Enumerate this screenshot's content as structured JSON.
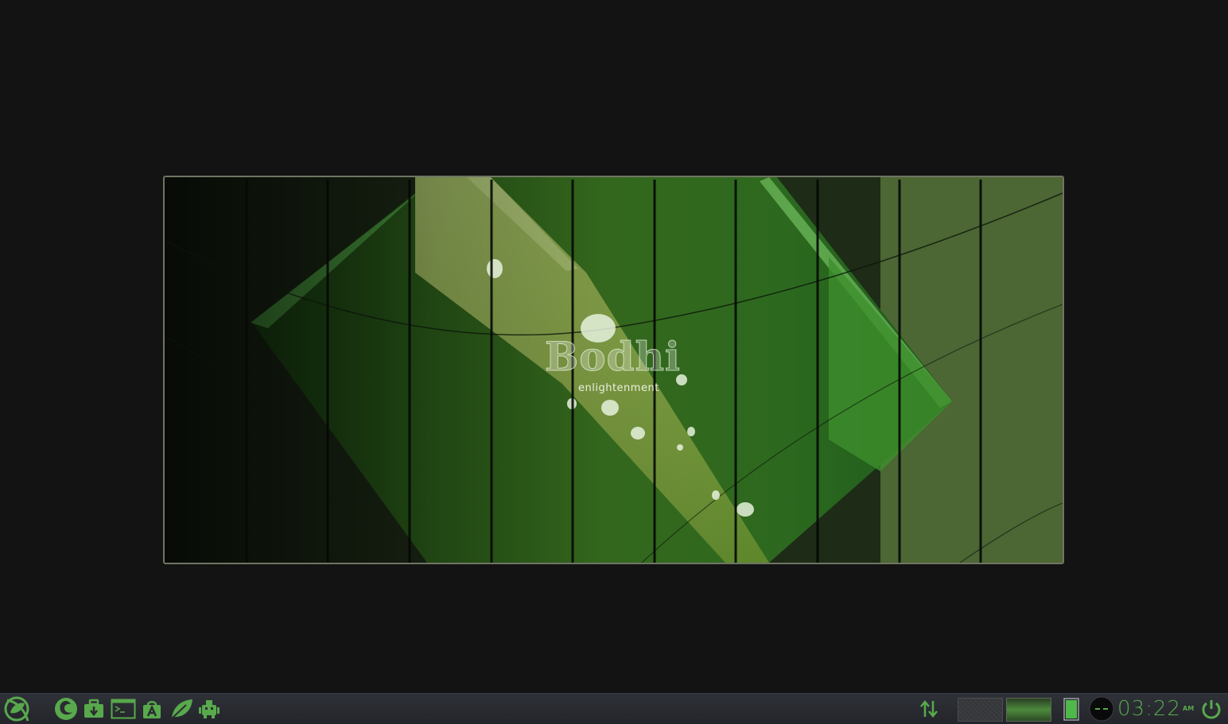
{
  "wallpaper": {
    "logo_title": "Bodhi",
    "logo_subtitle": "enlightenment",
    "bar_count": 11
  },
  "shelf": {
    "launchers": [
      {
        "name": "start-menu",
        "icon": "bodhi-leaf-icon"
      },
      {
        "name": "web-browser",
        "icon": "browser-icon"
      },
      {
        "name": "app-center",
        "icon": "briefcase-download-icon"
      },
      {
        "name": "terminal",
        "icon": "terminal-icon"
      },
      {
        "name": "software-store",
        "icon": "store-bag-icon"
      },
      {
        "name": "bodhi-leaf",
        "icon": "leaf-icon"
      },
      {
        "name": "package-manager",
        "icon": "robot-package-icon"
      }
    ],
    "network": {
      "icon": "network-transfer-icon"
    },
    "pager": {
      "desktops": 2,
      "active": 2
    },
    "battery": {
      "icon": "battery-icon",
      "level": 1.0
    },
    "clock": {
      "time": "03:22",
      "period": "AM"
    },
    "power": {
      "icon": "power-icon"
    }
  },
  "colors": {
    "accent": "#58a94c",
    "shelf_bg": "#2a2c31",
    "desktop_bg": "#131313"
  }
}
